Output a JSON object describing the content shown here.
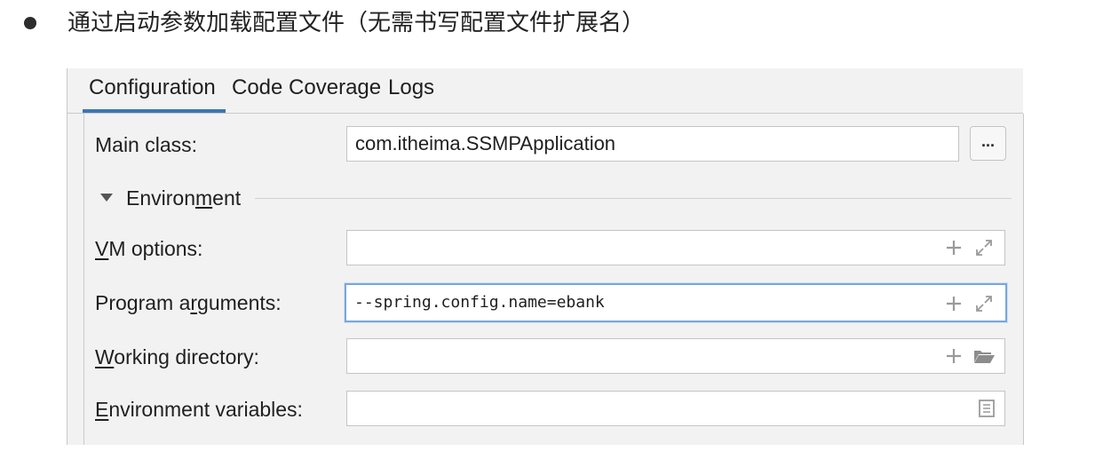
{
  "heading": {
    "text": "通过启动参数加载配置文件（无需书写配置文件扩展名）"
  },
  "tabs": [
    {
      "label": "Configuration",
      "active": true
    },
    {
      "label": "Code Coverage",
      "active": false
    },
    {
      "label": "Logs",
      "active": false
    }
  ],
  "main_class": {
    "label": "Main class:",
    "value": "com.itheima.SSMPApplication",
    "browse_label": "..."
  },
  "environment": {
    "label_pre": "Environ",
    "label_mnemonic": "m",
    "label_post": "ent",
    "expanded": true
  },
  "vm_options": {
    "label_mnemonic": "V",
    "label_rest": "M options:",
    "value": ""
  },
  "program_arguments": {
    "label_pre": "Program a",
    "label_mnemonic": "r",
    "label_post": "guments:",
    "value": "--spring.config.name=ebank"
  },
  "working_directory": {
    "label_mnemonic": "W",
    "label_rest": "orking directory:",
    "value": ""
  },
  "environment_variables": {
    "label_mnemonic": "E",
    "label_rest": "nvironment variables:",
    "value": ""
  },
  "icons": {
    "add": "plus-icon",
    "expand": "expand-icon",
    "folder": "folder-icon",
    "document": "document-icon",
    "collapse_arrow": "triangle-down-icon"
  },
  "colors": {
    "accent": "#3d75b5",
    "focus_border": "#7aa7da",
    "panel_bg": "#f2f2f2"
  }
}
